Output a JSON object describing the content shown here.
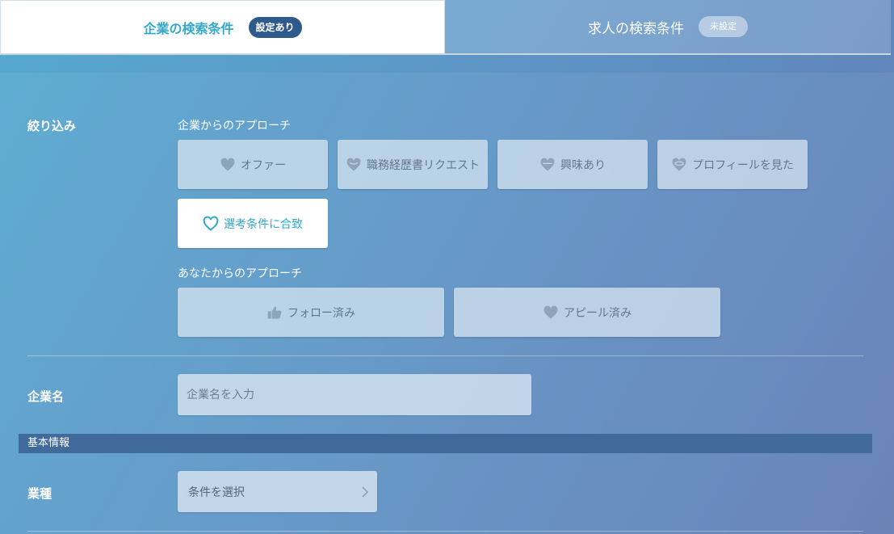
{
  "tabs": [
    {
      "label": "企業の検索条件",
      "badge": "設定あり",
      "active": true
    },
    {
      "label": "求人の検索条件",
      "badge": "未設定",
      "active": false
    }
  ],
  "filter": {
    "label": "絞り込み",
    "company_approach": {
      "label": "企業からのアプローチ",
      "options": [
        {
          "label": "オファー",
          "icon": "heart-icon",
          "selected": false
        },
        {
          "label": "職務経歴書リクエスト",
          "icon": "heart-icon",
          "selected": false
        },
        {
          "label": "興味あり",
          "icon": "heart-icon",
          "selected": false
        },
        {
          "label": "プロフィールを見た",
          "icon": "heart-icon",
          "selected": false
        },
        {
          "label": "選考条件に合致",
          "icon": "heart-icon",
          "selected": true
        }
      ]
    },
    "your_approach": {
      "label": "あなたからのアプローチ",
      "options": [
        {
          "label": "フォロー済み",
          "icon": "thumbs-up-icon",
          "selected": false
        },
        {
          "label": "アピール済み",
          "icon": "heart-icon",
          "selected": false
        }
      ]
    }
  },
  "company_name": {
    "label": "企業名",
    "placeholder": "企業名を入力"
  },
  "basic_info": {
    "header": "基本情報"
  },
  "industry": {
    "label": "業種",
    "select_label": "条件を選択"
  },
  "colors": {
    "accent": "#33a8c9",
    "badge_dark": "#2f5a8c",
    "section_bar": "#3f6a9a"
  }
}
